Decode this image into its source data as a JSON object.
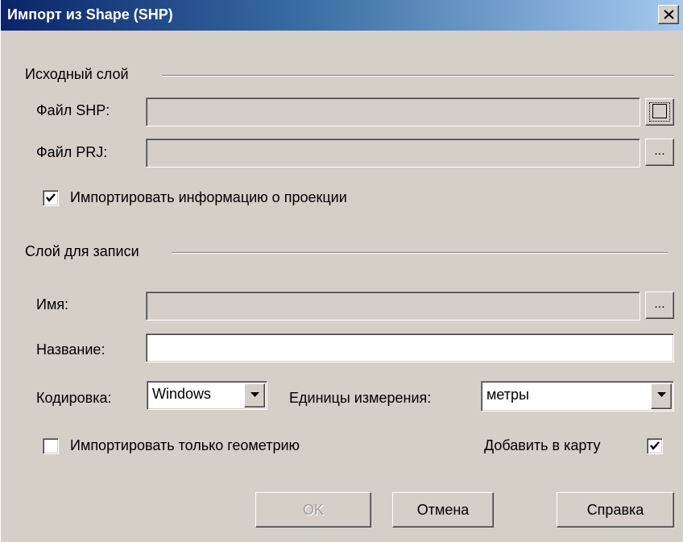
{
  "window": {
    "title": "Импорт из Shape (SHP)",
    "close_icon": "close-icon"
  },
  "source": {
    "group_label": "Исходный слой",
    "shp_label": "Файл SHP:",
    "shp_value": "",
    "prj_label": "Файл PRJ:",
    "prj_value": "",
    "browse_label": "...",
    "import_projection_label": "Импортировать информацию о проекции",
    "import_projection_checked": true
  },
  "target": {
    "group_label": "Слой для записи",
    "name_label": "Имя:",
    "name_value": "",
    "browse_label": "...",
    "title_label": "Название:",
    "title_value": "",
    "encoding_label": "Кодировка:",
    "encoding_value": "Windows",
    "units_label": "Единицы измерения:",
    "units_value": "метры",
    "geometry_only_label": "Импортировать только геометрию",
    "geometry_only_checked": false,
    "add_to_map_label": "Добавить в карту",
    "add_to_map_checked": true
  },
  "buttons": {
    "ok": "OK",
    "cancel": "Отмена",
    "help": "Справка"
  },
  "colors": {
    "face": "#d4d0c8",
    "title_start": "#0a246a",
    "title_end": "#a6caf0"
  }
}
